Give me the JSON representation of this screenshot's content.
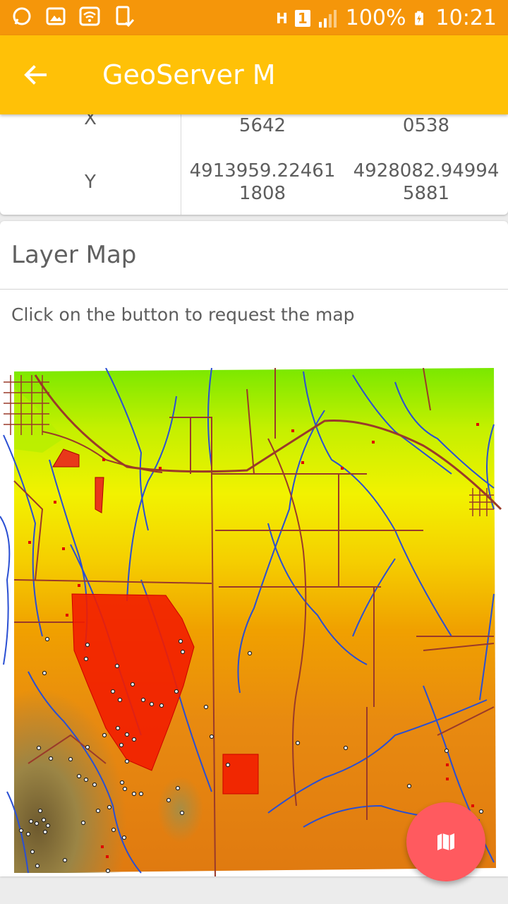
{
  "status_bar": {
    "left_icons": [
      "whatsapp-icon",
      "image-icon",
      "wifi-icon",
      "phone-check-icon"
    ],
    "network_h": "H",
    "sim_slot": "1",
    "battery": "100%",
    "time": "10:21"
  },
  "app_bar": {
    "title": "GeoServer M",
    "back_icon": "arrow-back-icon"
  },
  "bbox_table": {
    "rows": [
      {
        "label": "X",
        "min": "5642",
        "max": "0538"
      },
      {
        "label": "Y",
        "min": "4913959.22461\n1808",
        "max": "4928082.94994\n5881"
      }
    ]
  },
  "layer_map": {
    "heading": "Layer Map",
    "hint": "Click on the button to request the map"
  },
  "fab": {
    "icon": "map-icon"
  },
  "colors": {
    "status_bar": "#f5960a",
    "app_bar": "#ffc107",
    "fab": "#ff5a5f",
    "text": "#5d5d5d"
  }
}
